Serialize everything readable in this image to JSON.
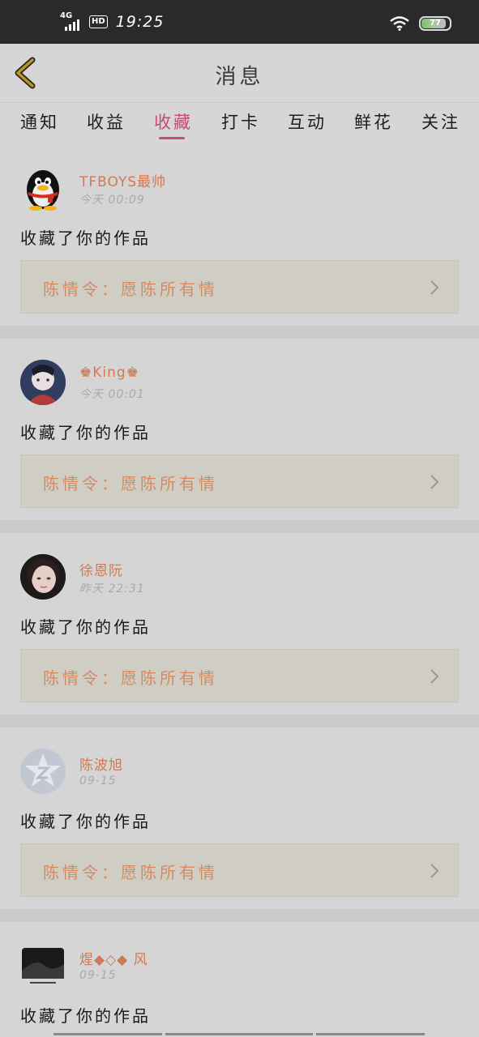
{
  "status": {
    "network": "4G",
    "hd": "HD",
    "time": "19:25",
    "battery": "77"
  },
  "header": {
    "title": "消息"
  },
  "tabs": [
    "通知",
    "收益",
    "收藏",
    "打卡",
    "互动",
    "鲜花",
    "关注"
  ],
  "active_tab": "收藏",
  "messages": [
    {
      "user": "TFBOYS最帅",
      "time": "今天 00:09",
      "action": "收藏了你的作品",
      "work": "陈情令：愿陈所有情",
      "avatar": "qq-penguin-icon"
    },
    {
      "user": "♚King♚",
      "time": "今天 00:01",
      "action": "收藏了你的作品",
      "work": "陈情令：愿陈所有情",
      "avatar": "anime-avatar"
    },
    {
      "user": "徐恩阮",
      "time": "昨天 22:31",
      "action": "收藏了你的作品",
      "work": "陈情令：愿陈所有情",
      "avatar": "photo-avatar"
    },
    {
      "user": "陈波旭",
      "time": "09-15",
      "action": "收藏了你的作品",
      "work": "陈情令：愿陈所有情",
      "avatar": "default-star-avatar"
    },
    {
      "user": "煋◆◇◆ 风",
      "time": "09-15",
      "action": "收藏了你的作品",
      "avatar": "dark-photo-avatar"
    }
  ],
  "colors": {
    "accent": "#c64a73",
    "username": "#d07a55",
    "work_title": "#d58a60",
    "back_arrow": "#b8962a"
  }
}
